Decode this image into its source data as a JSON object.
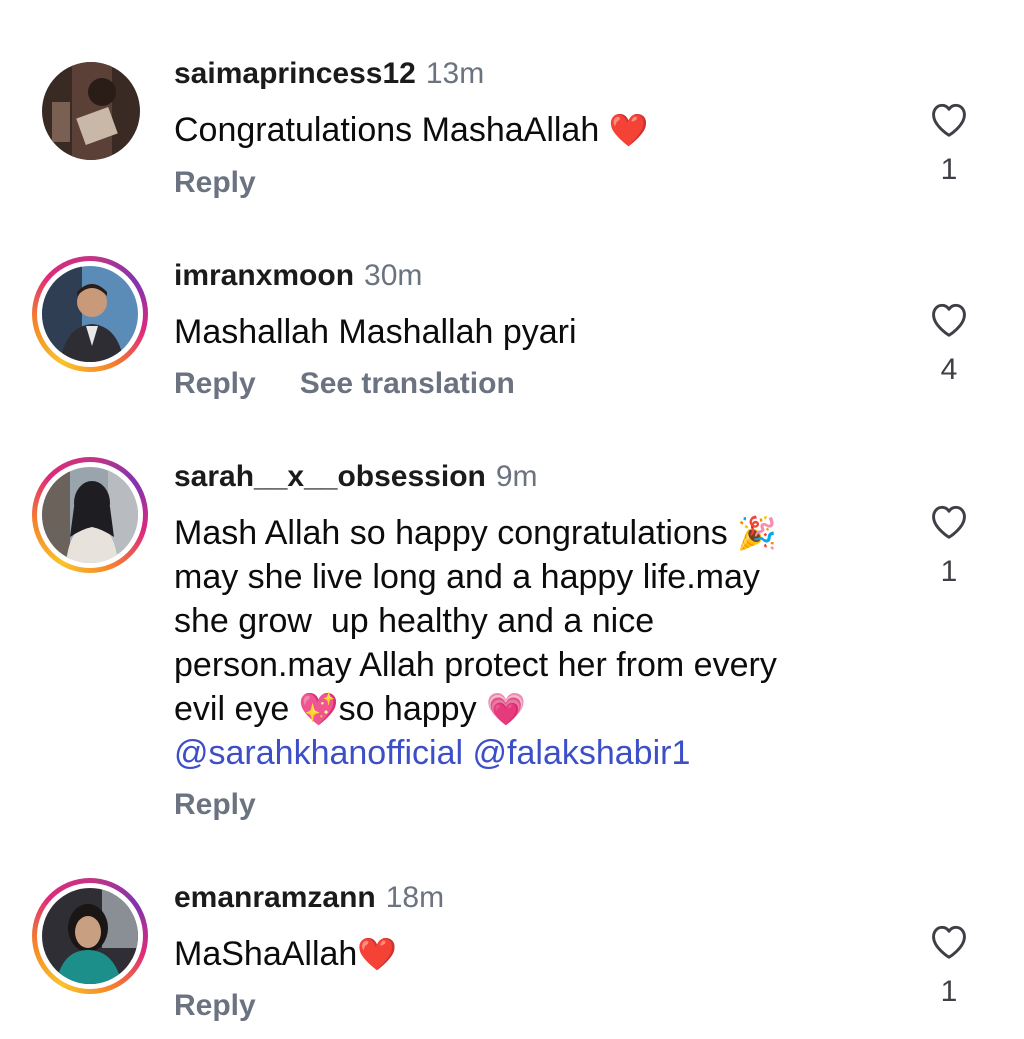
{
  "comments": [
    {
      "username": "saimaprincess12",
      "time": "13m",
      "text": "Congratulations MashaAllah",
      "text_emoji": "❤️",
      "reply_label": "Reply",
      "likes": "1",
      "avatar_story_ring": false
    },
    {
      "username": "imranxmoon",
      "time": "30m",
      "text": "Mashallah Mashallah pyari",
      "reply_label": "Reply",
      "translate_label": "See translation",
      "likes": "4",
      "avatar_story_ring": true
    },
    {
      "username": "sarah__x__obsession",
      "time": "9m",
      "text_line1": "Mash Allah so happy congratulations",
      "emoji_party": "🎉",
      "text_line2": "may she live long and a happy life.may",
      "text_line3": "she grow  up healthy and a nice",
      "text_line4": "person.may Allah protect her from every",
      "text_line5a": "evil eye",
      "emoji_sparkle_heart": "💖",
      "text_line5b": "so happy",
      "emoji_beating_heart": "💗",
      "mention1": "@sarahkhanofficial",
      "mention2": "@falakshabir1",
      "reply_label": "Reply",
      "likes": "1",
      "avatar_story_ring": true
    },
    {
      "username": "emanramzann",
      "time": "18m",
      "text": "MaShaAllah",
      "text_emoji": "❤️",
      "reply_label": "Reply",
      "likes": "1",
      "avatar_story_ring": true
    }
  ],
  "icons": {
    "like": "heart-outline-icon"
  },
  "colors": {
    "mention": "#3d4fc7",
    "muted": "#6b7280",
    "heart_emoji": "#e0245e"
  }
}
